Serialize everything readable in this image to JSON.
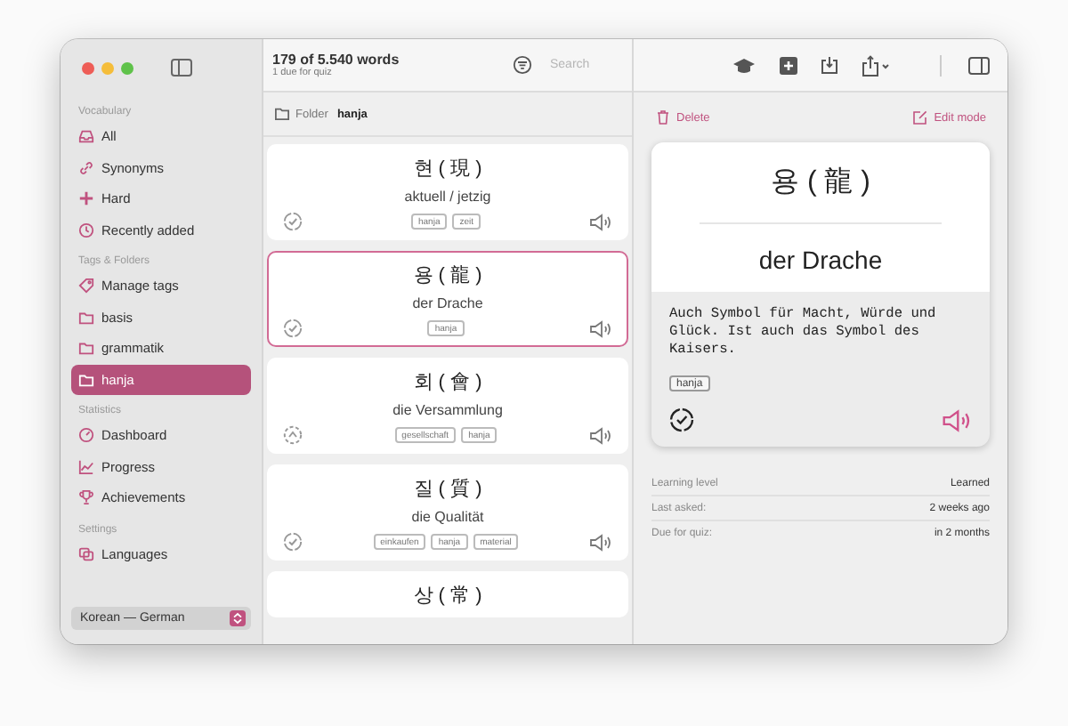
{
  "sidebar": {
    "sections": [
      {
        "heading": "Vocabulary",
        "items": [
          {
            "label": "All",
            "selected": false
          },
          {
            "label": "Synonyms",
            "selected": false
          },
          {
            "label": "Hard",
            "selected": false
          },
          {
            "label": "Recently added",
            "selected": false
          }
        ]
      },
      {
        "heading": "Tags & Folders",
        "items": [
          {
            "label": "Manage tags",
            "selected": false
          },
          {
            "label": "basis",
            "selected": false
          },
          {
            "label": "grammatik",
            "selected": false
          },
          {
            "label": "hanja",
            "selected": true
          }
        ]
      },
      {
        "heading": "Statistics",
        "items": [
          {
            "label": "Dashboard",
            "selected": false
          },
          {
            "label": "Progress",
            "selected": false
          },
          {
            "label": "Achievements",
            "selected": false
          }
        ]
      },
      {
        "heading": "Settings",
        "items": [
          {
            "label": "Languages",
            "selected": false
          }
        ]
      }
    ],
    "language_picker": "Korean — German"
  },
  "list": {
    "title": "179 of 5.540 words",
    "subtitle": "1 due for quiz",
    "search": {
      "placeholder": "Search"
    },
    "folder_label": "Folder",
    "folder_name": "hanja",
    "cards": [
      {
        "word": "현 ( 現 )",
        "translation": "aktuell / jetzig",
        "tags": [
          "hanja",
          "zeit"
        ],
        "learned": true,
        "selected": false
      },
      {
        "word": "용 ( 龍 )",
        "translation": "der Drache",
        "tags": [
          "hanja"
        ],
        "learned": true,
        "selected": true
      },
      {
        "word": "회 ( 會 )",
        "translation": "die Versammlung",
        "tags": [
          "gesellschaft",
          "hanja"
        ],
        "learned": false,
        "selected": false
      },
      {
        "word": "질 ( 質 )",
        "translation": "die Qualität",
        "tags": [
          "einkaufen",
          "hanja",
          "material"
        ],
        "learned": true,
        "selected": false
      },
      {
        "word": "상 ( 常 )",
        "selected": false
      }
    ]
  },
  "detail": {
    "delete": "Delete",
    "edit": "Edit mode",
    "word": "용 ( 龍 )",
    "translation": "der Drache",
    "note": "Auch Symbol für Macht, Würde und Glück. Ist auch das Symbol des Kaisers.",
    "tags": [
      "hanja"
    ],
    "learned": true,
    "stats": [
      {
        "label": "Learning level",
        "value": "Learned"
      },
      {
        "label": "Last asked:",
        "value": "2 weeks ago"
      },
      {
        "label": "Due for quiz:",
        "value": "in 2 months"
      }
    ]
  }
}
